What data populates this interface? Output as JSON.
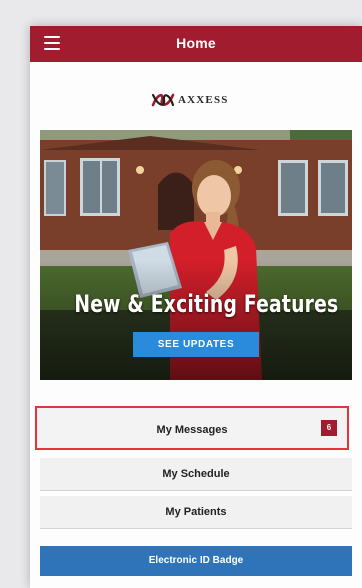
{
  "header": {
    "title": "Home",
    "menu_icon": "hamburger-menu-icon",
    "color": "#a01c2e"
  },
  "logo": {
    "text": "AXXESS"
  },
  "banner": {
    "headline": "New & Exciting Features",
    "button_label": "SEE UPDATES",
    "button_color": "#2a8adb"
  },
  "menu": {
    "messages": {
      "label": "My Messages",
      "badge": "6"
    },
    "schedule": {
      "label": "My Schedule"
    },
    "patients": {
      "label": "My Patients"
    },
    "electronic_id": {
      "label": "Electronic ID Badge",
      "color": "#2f74b8"
    }
  },
  "highlight_color": "#e3343e"
}
